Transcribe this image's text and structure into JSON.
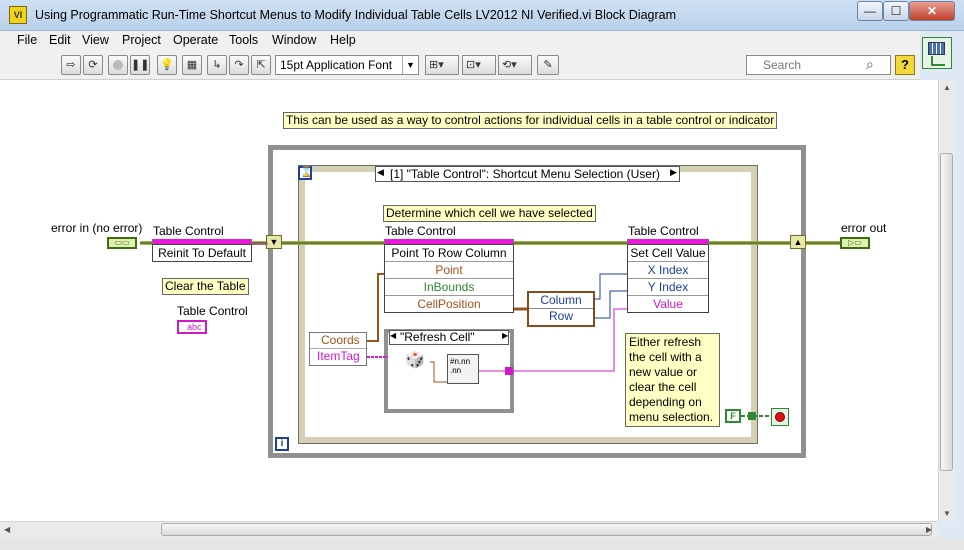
{
  "window": {
    "title": "Using Programmatic Run-Time Shortcut Menus to Modify Individual Table Cells LV2012 NI Verified.vi Block Diagram",
    "icon": "labview-vi-icon",
    "min_glyph": "—",
    "max_glyph": "☐",
    "close_glyph": "✕"
  },
  "menu": [
    "File",
    "Edit",
    "View",
    "Project",
    "Operate",
    "Tools",
    "Window",
    "Help"
  ],
  "toolbar": {
    "font": "15pt Application Font",
    "search_placeholder": "Search",
    "help_glyph": "?"
  },
  "diagram": {
    "comment_top": "This can be used as a way to control actions for individual cells in a table control or indicator",
    "error_in_label": "error in (no error)",
    "error_out_label": "error out",
    "table_control_label": "Table Control",
    "reinit_method": "Reinit To Default",
    "clear_comment": "Clear the Table",
    "table_terminal_label": "Table Control",
    "table_terminal_text": "abc",
    "event_selector": "[1] \"Table Control\": Shortcut Menu Selection (User)",
    "event_dd": "▾",
    "cell_comment": "Determine which cell we have selected",
    "point_node_label": "Table Control",
    "point_node_method": "Point To Row Column",
    "point_inputs": [
      "Point",
      "InBounds",
      "CellPosition"
    ],
    "cluster_fields": [
      "Column",
      "Row"
    ],
    "set_node_label": "Table Control",
    "set_node_method": "Set Cell Value",
    "set_inputs": [
      "X Index",
      "Y Index",
      "Value"
    ],
    "event_data": [
      "Coords",
      "ItemTag"
    ],
    "case_selector": "\"Refresh Cell\"",
    "refresh_comment": "Either refresh the cell with a new value or clear the cell depending on menu selection.",
    "stop_constant": "F",
    "loop_index": "i"
  }
}
